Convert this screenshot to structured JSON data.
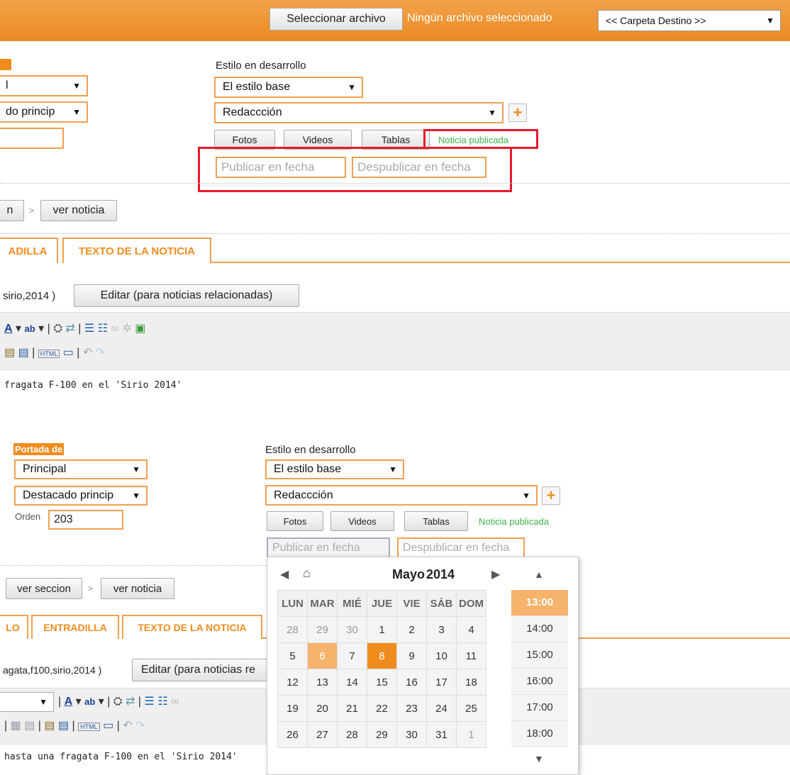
{
  "topbar": {
    "file_button": "Seleccionar archivo",
    "file_status": "Ningún archivo seleccionado",
    "folder_select": "<< Carpeta Destino >>"
  },
  "top_panel": {
    "portada_label": "",
    "portada_select": "l",
    "destacado_select": "do princip",
    "orden_value": "",
    "style_label": "Estilo en desarrollo",
    "style_select": "El estilo base",
    "section_select": "Redaccción",
    "fotos": "Fotos",
    "videos": "Videos",
    "tablas": "Tablas",
    "status": "Noticia publicada",
    "publish_placeholder": "Publicar en fecha",
    "unpublish_placeholder": "Despublicar en fecha",
    "nav_left": "n",
    "nav_sep": ">",
    "ver_noticia": "ver noticia",
    "tab_entradilla": "ADILLA",
    "tab_texto": "TEXTO DE LA NOTICIA",
    "tags_text": "sirio,2014 )",
    "edit_button": "Editar (para noticias relacionadas)",
    "content_text": "fragata F-100 en el 'Sirio 2014'"
  },
  "bottom_panel": {
    "portada_label": "Portada de",
    "portada_select": "Principal",
    "destacado_select": "Destacado princip",
    "orden_label": "Orden",
    "orden_value": "203",
    "style_label": "Estilo en desarrollo",
    "style_select": "El estilo base",
    "section_select": "Redaccción",
    "fotos": "Fotos",
    "videos": "Videos",
    "tablas": "Tablas",
    "status": "Noticia publicada",
    "publish_placeholder": "Publicar en fecha",
    "unpublish_placeholder": "Despublicar en fecha",
    "ver_seccion": "ver seccion",
    "nav_sep": ">",
    "ver_noticia": "ver noticia",
    "tab_lo": "LO",
    "tab_entradilla": "ENTRADILLA",
    "tab_texto": "TEXTO DE LA NOTICIA",
    "tags_text": "agata,f100,sirio,2014 )",
    "edit_button": "Editar (para noticias re",
    "content_text": "hasta una fragata F-100 en el 'Sirio 2014'"
  },
  "calendar": {
    "month": "Mayo",
    "year": "2014",
    "weekdays": [
      "LUN",
      "MAR",
      "MIÉ",
      "JUE",
      "VIE",
      "SÁB",
      "DOM"
    ],
    "weeks": [
      [
        "28",
        "29",
        "30",
        "1",
        "2",
        "3",
        "4"
      ],
      [
        "5",
        "6",
        "7",
        "8",
        "9",
        "10",
        "11"
      ],
      [
        "12",
        "13",
        "14",
        "15",
        "16",
        "17",
        "18"
      ],
      [
        "19",
        "20",
        "21",
        "22",
        "23",
        "24",
        "25"
      ],
      [
        "26",
        "27",
        "28",
        "29",
        "30",
        "31",
        "1"
      ]
    ],
    "selected_day": "6",
    "today_day": "8",
    "times": [
      "13:00",
      "14:00",
      "15:00",
      "16:00",
      "17:00",
      "18:00"
    ],
    "active_time": "13:00"
  },
  "colors": {
    "accent": "#f08c1e",
    "highlight": "#e8192c",
    "status_green": "#3bb34a"
  }
}
